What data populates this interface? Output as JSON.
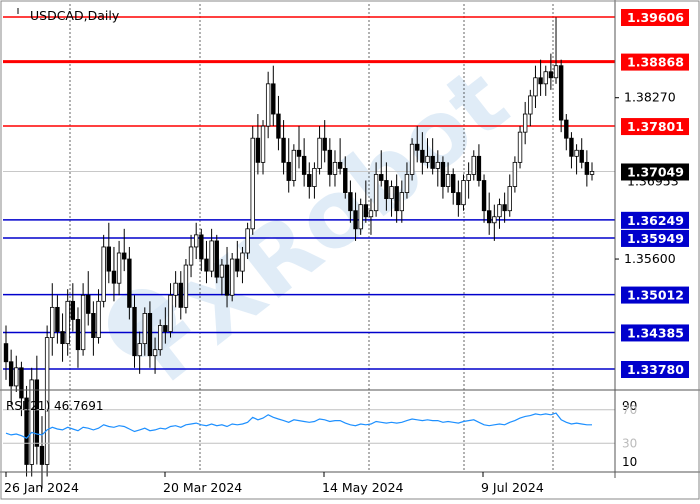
{
  "chart_data": {
    "type": "candlestick",
    "symbol_label": "USDCAD,Daily",
    "watermark": "FXRobot",
    "colors": {
      "background": "#ffffff",
      "candle": "#000000",
      "support": "#0000cc",
      "resistance": "#ff0000",
      "current_price_bg": "#000000",
      "rsi_line": "#1e90ff",
      "watermark": "#d6e6f4"
    },
    "price_axis": {
      "min": 1.3756,
      "max": 1.3978,
      "ticks": [
        1.3827,
        1.356
      ]
    },
    "resistance_levels": [
      1.39606,
      1.38868,
      1.37801
    ],
    "support_levels": [
      1.36249,
      1.35949,
      1.35012,
      1.34385,
      1.3378
    ],
    "level_labels": [
      "1.39606",
      "1.38868",
      "1.37801",
      "1.36249",
      "1.35949",
      "1.35012",
      "1.34385",
      "1.33780"
    ],
    "tick_labels": [
      "1.38270",
      "1.35600"
    ],
    "current_price": {
      "value": 1.37049,
      "label": "1.37049",
      "hidden_label": "1.36953"
    },
    "x_axis": {
      "labels": [
        "26 Jan 2024",
        "20 Mar 2024",
        "14 May 2024",
        "9 Jul 2024"
      ]
    },
    "rsi": {
      "label": "RSI(21) 46.7691",
      "period": 21,
      "value": 46.7691,
      "levels": [
        "90",
        "70",
        "30",
        "10"
      ]
    },
    "candles_ohlc": [
      [
        1.342,
        1.345,
        1.336,
        1.339
      ],
      [
        1.339,
        1.341,
        1.332,
        1.335
      ],
      [
        1.335,
        1.34,
        1.334,
        1.338
      ],
      [
        1.338,
        1.339,
        1.33,
        1.333
      ],
      [
        1.333,
        1.335,
        1.32,
        1.322
      ],
      [
        1.322,
        1.338,
        1.32,
        1.336
      ],
      [
        1.336,
        1.34,
        1.322,
        1.325
      ],
      [
        1.325,
        1.33,
        1.318,
        1.322
      ],
      [
        1.322,
        1.345,
        1.32,
        1.343
      ],
      [
        1.343,
        1.352,
        1.34,
        1.348
      ],
      [
        1.348,
        1.35,
        1.342,
        1.344
      ],
      [
        1.344,
        1.347,
        1.339,
        1.342
      ],
      [
        1.342,
        1.351,
        1.34,
        1.349
      ],
      [
        1.349,
        1.352,
        1.344,
        1.346
      ],
      [
        1.346,
        1.348,
        1.338,
        1.341
      ],
      [
        1.341,
        1.352,
        1.34,
        1.35
      ],
      [
        1.35,
        1.354,
        1.345,
        1.347
      ],
      [
        1.347,
        1.349,
        1.34,
        1.343
      ],
      [
        1.343,
        1.351,
        1.342,
        1.349
      ],
      [
        1.349,
        1.36,
        1.348,
        1.358
      ],
      [
        1.358,
        1.362,
        1.352,
        1.354
      ],
      [
        1.354,
        1.358,
        1.349,
        1.352
      ],
      [
        1.352,
        1.359,
        1.35,
        1.357
      ],
      [
        1.357,
        1.361,
        1.354,
        1.356
      ],
      [
        1.356,
        1.358,
        1.346,
        1.348
      ],
      [
        1.348,
        1.35,
        1.338,
        1.34
      ],
      [
        1.34,
        1.344,
        1.337,
        1.342
      ],
      [
        1.342,
        1.348,
        1.34,
        1.347
      ],
      [
        1.347,
        1.349,
        1.338,
        1.34
      ],
      [
        1.34,
        1.343,
        1.337,
        1.341
      ],
      [
        1.341,
        1.346,
        1.34,
        1.345
      ],
      [
        1.345,
        1.348,
        1.342,
        1.344
      ],
      [
        1.344,
        1.352,
        1.343,
        1.35
      ],
      [
        1.35,
        1.354,
        1.348,
        1.352
      ],
      [
        1.352,
        1.354,
        1.346,
        1.348
      ],
      [
        1.348,
        1.356,
        1.347,
        1.355
      ],
      [
        1.355,
        1.36,
        1.353,
        1.358
      ],
      [
        1.358,
        1.362,
        1.356,
        1.36
      ],
      [
        1.36,
        1.361,
        1.354,
        1.356
      ],
      [
        1.356,
        1.359,
        1.352,
        1.354
      ],
      [
        1.354,
        1.361,
        1.353,
        1.359
      ],
      [
        1.359,
        1.36,
        1.352,
        1.353
      ],
      [
        1.353,
        1.356,
        1.35,
        1.355
      ],
      [
        1.355,
        1.358,
        1.348,
        1.35
      ],
      [
        1.35,
        1.357,
        1.349,
        1.356
      ],
      [
        1.356,
        1.359,
        1.353,
        1.354
      ],
      [
        1.354,
        1.358,
        1.352,
        1.357
      ],
      [
        1.357,
        1.362,
        1.356,
        1.361
      ],
      [
        1.361,
        1.378,
        1.36,
        1.376
      ],
      [
        1.376,
        1.38,
        1.37,
        1.372
      ],
      [
        1.372,
        1.379,
        1.37,
        1.378
      ],
      [
        1.378,
        1.387,
        1.376,
        1.385
      ],
      [
        1.385,
        1.388,
        1.378,
        1.38
      ],
      [
        1.38,
        1.383,
        1.374,
        1.376
      ],
      [
        1.376,
        1.379,
        1.37,
        1.372
      ],
      [
        1.372,
        1.376,
        1.367,
        1.369
      ],
      [
        1.369,
        1.375,
        1.368,
        1.374
      ],
      [
        1.374,
        1.378,
        1.371,
        1.373
      ],
      [
        1.373,
        1.376,
        1.368,
        1.37
      ],
      [
        1.37,
        1.372,
        1.366,
        1.368
      ],
      [
        1.368,
        1.372,
        1.366,
        1.371
      ],
      [
        1.371,
        1.378,
        1.37,
        1.376
      ],
      [
        1.376,
        1.379,
        1.372,
        1.374
      ],
      [
        1.374,
        1.376,
        1.368,
        1.37
      ],
      [
        1.37,
        1.374,
        1.368,
        1.372
      ],
      [
        1.372,
        1.376,
        1.37,
        1.371
      ],
      [
        1.371,
        1.373,
        1.366,
        1.367
      ],
      [
        1.367,
        1.369,
        1.362,
        1.364
      ],
      [
        1.364,
        1.367,
        1.359,
        1.361
      ],
      [
        1.361,
        1.366,
        1.36,
        1.365
      ],
      [
        1.365,
        1.369,
        1.362,
        1.363
      ],
      [
        1.363,
        1.366,
        1.36,
        1.364
      ],
      [
        1.364,
        1.372,
        1.363,
        1.37
      ],
      [
        1.37,
        1.374,
        1.368,
        1.369
      ],
      [
        1.369,
        1.372,
        1.364,
        1.366
      ],
      [
        1.366,
        1.369,
        1.363,
        1.368
      ],
      [
        1.368,
        1.37,
        1.362,
        1.364
      ],
      [
        1.364,
        1.369,
        1.362,
        1.367
      ],
      [
        1.367,
        1.372,
        1.366,
        1.37
      ],
      [
        1.37,
        1.376,
        1.369,
        1.375
      ],
      [
        1.375,
        1.378,
        1.372,
        1.374
      ],
      [
        1.374,
        1.377,
        1.37,
        1.372
      ],
      [
        1.372,
        1.376,
        1.371,
        1.373
      ],
      [
        1.373,
        1.376,
        1.37,
        1.371
      ],
      [
        1.371,
        1.374,
        1.368,
        1.372
      ],
      [
        1.372,
        1.373,
        1.366,
        1.368
      ],
      [
        1.368,
        1.372,
        1.367,
        1.37
      ],
      [
        1.37,
        1.371,
        1.365,
        1.367
      ],
      [
        1.367,
        1.369,
        1.363,
        1.365
      ],
      [
        1.365,
        1.37,
        1.364,
        1.369
      ],
      [
        1.369,
        1.372,
        1.366,
        1.37
      ],
      [
        1.37,
        1.374,
        1.369,
        1.373
      ],
      [
        1.373,
        1.375,
        1.368,
        1.369
      ],
      [
        1.369,
        1.37,
        1.362,
        1.364
      ],
      [
        1.364,
        1.367,
        1.36,
        1.362
      ],
      [
        1.362,
        1.365,
        1.359,
        1.363
      ],
      [
        1.363,
        1.366,
        1.361,
        1.365
      ],
      [
        1.365,
        1.367,
        1.362,
        1.364
      ],
      [
        1.364,
        1.37,
        1.363,
        1.368
      ],
      [
        1.368,
        1.373,
        1.367,
        1.372
      ],
      [
        1.372,
        1.378,
        1.371,
        1.377
      ],
      [
        1.377,
        1.382,
        1.375,
        1.38
      ],
      [
        1.38,
        1.384,
        1.378,
        1.383
      ],
      [
        1.383,
        1.388,
        1.381,
        1.386
      ],
      [
        1.386,
        1.389,
        1.383,
        1.385
      ],
      [
        1.385,
        1.388,
        1.383,
        1.387
      ],
      [
        1.387,
        1.39,
        1.384,
        1.386
      ],
      [
        1.386,
        1.396,
        1.385,
        1.388
      ],
      [
        1.388,
        1.389,
        1.377,
        1.379
      ],
      [
        1.379,
        1.38,
        1.374,
        1.376
      ],
      [
        1.376,
        1.377,
        1.371,
        1.373
      ],
      [
        1.373,
        1.375,
        1.37,
        1.374
      ],
      [
        1.374,
        1.376,
        1.371,
        1.372
      ],
      [
        1.372,
        1.374,
        1.368,
        1.37
      ],
      [
        1.37,
        1.372,
        1.369,
        1.3705
      ]
    ],
    "rsi_values": [
      42,
      40,
      41,
      39,
      36,
      43,
      41,
      40,
      46,
      49,
      47,
      46,
      49,
      47,
      45,
      49,
      48,
      46,
      48,
      52,
      50,
      49,
      51,
      50,
      47,
      44,
      46,
      48,
      45,
      46,
      48,
      47,
      50,
      51,
      49,
      52,
      53,
      54,
      52,
      51,
      53,
      51,
      52,
      50,
      53,
      52,
      53,
      55,
      61,
      58,
      60,
      64,
      61,
      59,
      57,
      55,
      58,
      57,
      56,
      55,
      56,
      59,
      58,
      56,
      57,
      57,
      54,
      52,
      51,
      53,
      52,
      53,
      56,
      55,
      54,
      55,
      54,
      55,
      57,
      59,
      58,
      57,
      58,
      57,
      57,
      55,
      56,
      55,
      54,
      56,
      57,
      58,
      55,
      52,
      51,
      52,
      53,
      52,
      55,
      57,
      60,
      62,
      63,
      65,
      64,
      65,
      64,
      66,
      58,
      55,
      53,
      54,
      53,
      52,
      52
    ]
  }
}
